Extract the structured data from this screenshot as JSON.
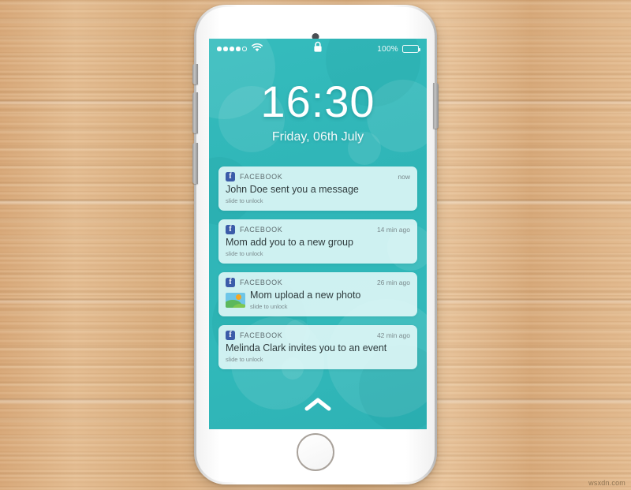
{
  "background": {
    "surface": "wooden-desk",
    "wood_color": "#dcb183"
  },
  "watermark": {
    "text": "wsxdn.com"
  },
  "device": {
    "type": "smartphone",
    "body_color": "#ffffff",
    "buttons": {
      "silent_switch": "Silent switch",
      "volume_up": "Volume up",
      "volume_down": "Volume down",
      "power": "Power / Sleep",
      "home": "Home button"
    }
  },
  "screen": {
    "wallpaper_color": "#31b9ba",
    "status_bar": {
      "signal_dots_filled": 4,
      "signal_dots_total": 5,
      "wifi_icon": "wifi-icon",
      "lock_icon": "lock-icon",
      "battery_percent": "100%",
      "battery_level": 100
    },
    "clock": {
      "time": "16:30",
      "date": "Friday, 06th July"
    },
    "notifications": [
      {
        "app": "FACEBOOK",
        "app_icon": "facebook-icon",
        "icon_glyph": "f",
        "time": "now",
        "title": "John Doe sent you a message",
        "hint": "slide to unlock",
        "has_thumbnail": false
      },
      {
        "app": "FACEBOOK",
        "app_icon": "facebook-icon",
        "icon_glyph": "f",
        "time": "14 min ago",
        "title": "Mom add you to a new group",
        "hint": "slide to unlock",
        "has_thumbnail": false
      },
      {
        "app": "FACEBOOK",
        "app_icon": "facebook-icon",
        "icon_glyph": "f",
        "time": "26 min ago",
        "title": "Mom upload a new photo",
        "hint": "slide to unlock",
        "has_thumbnail": true,
        "thumbnail": "photo-thumbnail"
      },
      {
        "app": "FACEBOOK",
        "app_icon": "facebook-icon",
        "icon_glyph": "f",
        "time": "42 min ago",
        "title": "Melinda Clark invites you to an event",
        "hint": "slide to unlock",
        "has_thumbnail": false
      }
    ],
    "unlock_affordance": {
      "icon": "chevron-up-icon"
    }
  }
}
